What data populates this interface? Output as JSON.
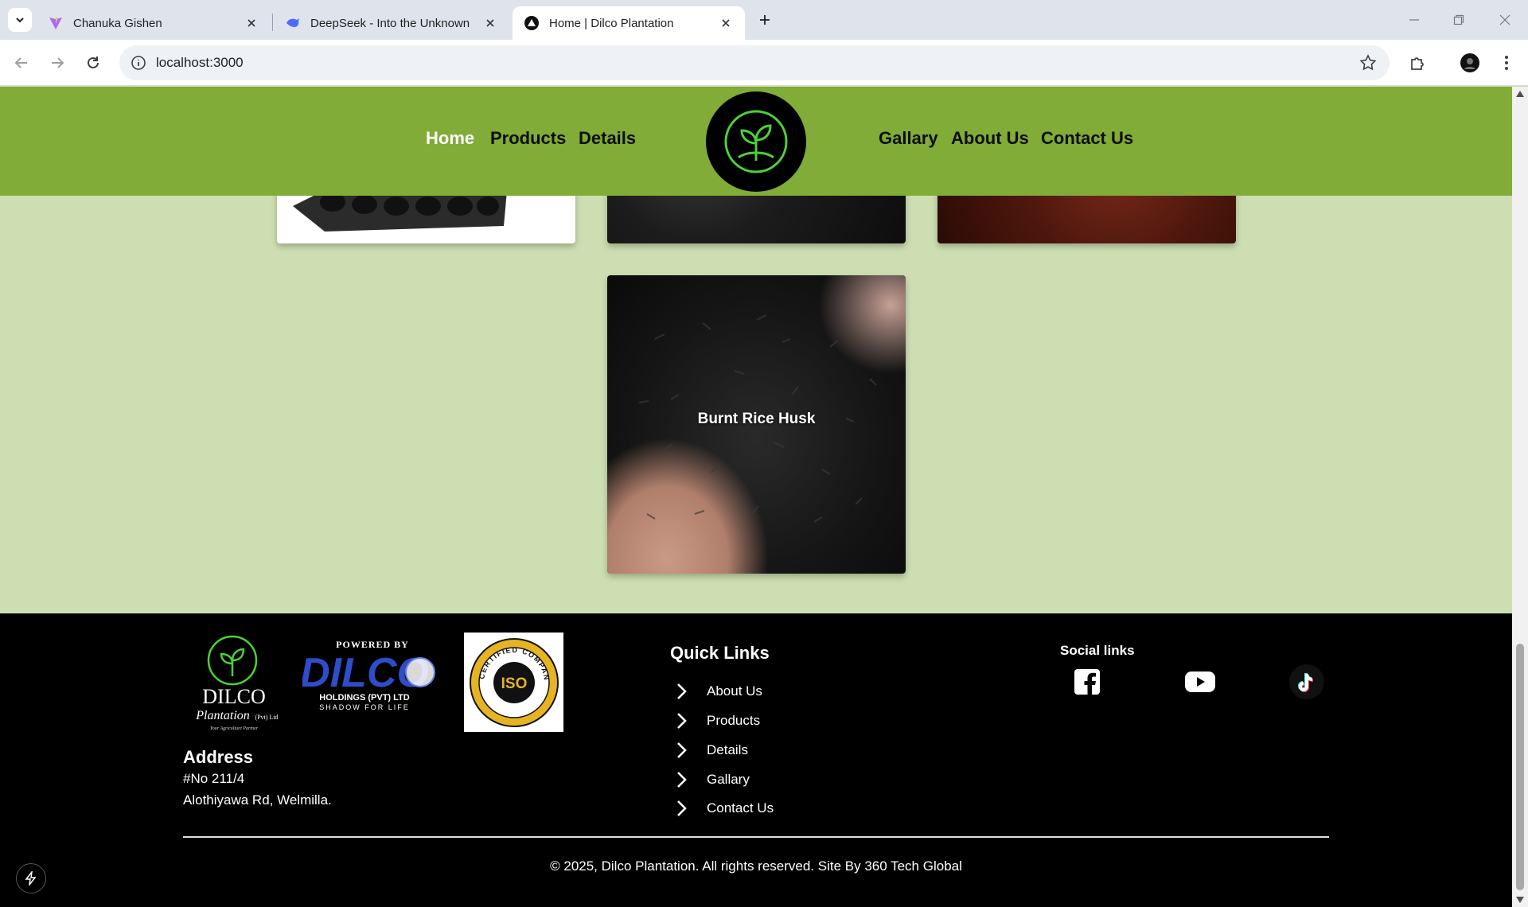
{
  "browser": {
    "tabs": [
      {
        "title": "Chanuka Gishen",
        "favicon": "vite-icon"
      },
      {
        "title": "DeepSeek - Into the Unknown",
        "favicon": "deepseek-icon"
      },
      {
        "title": "Home | Dilco Plantation",
        "favicon": "nextjs-icon",
        "active": true
      }
    ],
    "url": "localhost:3000"
  },
  "header": {
    "nav_left": [
      "Home",
      "Products",
      "Details"
    ],
    "nav_right": [
      "Gallary",
      "About Us",
      "Contact Us"
    ],
    "active": "Home",
    "brand_color": "#80ac37"
  },
  "products": {
    "featured_label": "Burnt Rice Husk"
  },
  "footer": {
    "logos": {
      "dilco_text": "DILCO",
      "plantation_text": "Plantation",
      "pvt_text": "(Pvt) Ltd",
      "tagline": "Your Agriculture Partner",
      "powered_by": "POWERED BY",
      "holdings_brand": "DILCO",
      "holdings_text": "HOLDINGS (PVT) LTD",
      "holdings_tagline": "SHADOW FOR LIFE",
      "iso_text": "ISO",
      "iso_ring_text": "CERTIFIED COMPANY"
    },
    "address": {
      "title": "Address",
      "line1": "#No 211/4",
      "line2": "Alothiyawa Rd, Welmilla."
    },
    "quick_links": {
      "title": "Quick Links",
      "items": [
        "About Us",
        "Products",
        "Details",
        "Gallary",
        "Contact Us"
      ]
    },
    "social": {
      "title": "Social links",
      "items": [
        "facebook-icon",
        "youtube-icon",
        "tiktok-icon"
      ]
    },
    "copyright": "© 2025, Dilco Plantation. All rights reserved. Site By 360 Tech Global"
  }
}
